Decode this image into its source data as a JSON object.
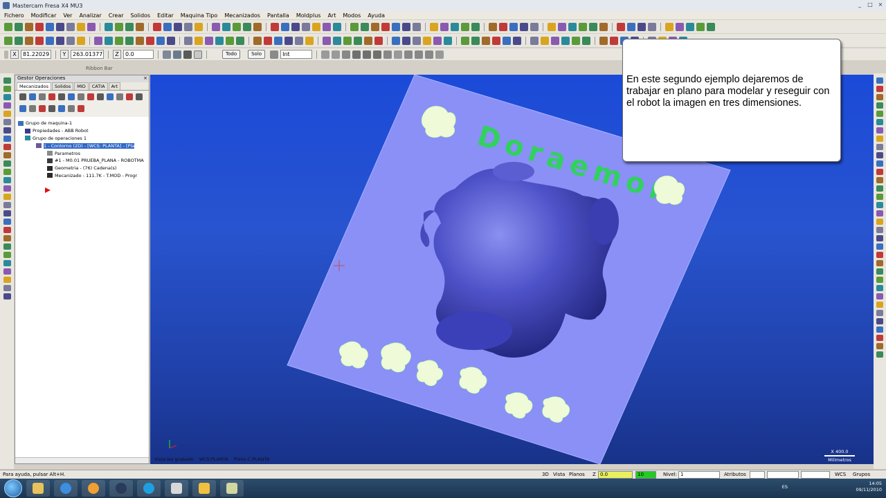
{
  "app": {
    "title": "Mastercam Fresa X4 MU3",
    "window_controls": [
      "_",
      "□",
      "×"
    ]
  },
  "menu": [
    "Fichero",
    "Modificar",
    "Ver",
    "Analizar",
    "Crear",
    "Solidos",
    "Editar",
    "Maquina Tipo",
    "Mecanizados",
    "Pantalla",
    "Moldplus",
    "Art",
    "Modos",
    "Ayuda"
  ],
  "coords": {
    "x_label": "X",
    "x_value": "81.22029",
    "y_label": "Y",
    "y_value": "263.01377",
    "z_label": "Z",
    "z_value": "0.0",
    "btn_todo": "Todo",
    "btn_solo": "Solo",
    "snap_value": "Int"
  },
  "ribbon_label": "Ribbon Bar",
  "panel": {
    "title": "Gestor Operaciones",
    "close": "×",
    "tabs": [
      "Mecanizados",
      "Solidos",
      "MID",
      "CATIA",
      "Art"
    ],
    "tree": [
      {
        "text": "Grupo de maquina-1",
        "indent": 4
      },
      {
        "text": "Propiedades - ABB Robot",
        "indent": 14
      },
      {
        "text": "Grupo de operaciones 1",
        "indent": 14
      },
      {
        "text": "1 - Contorno (2D) - [WCS: PLANTA] - [Pla",
        "indent": 30,
        "selected": true
      },
      {
        "text": "Parametros",
        "indent": 46
      },
      {
        "text": "#1 - M0.01 PRUEBA_PLANA - ROBOTMA",
        "indent": 46
      },
      {
        "text": "Geometria - (76) Cadena(s)",
        "indent": 46
      },
      {
        "text": "Mecanizado - 111.7K - T.MOD - Progr",
        "indent": 46
      }
    ]
  },
  "viewport": {
    "labels": [
      "Vista:Iso grabado",
      "WCS:PLANTA",
      "Plano C:PLANTA"
    ],
    "units_top": "X 400.0",
    "units": "Milimetros",
    "plate_text": "Doraemon"
  },
  "callout": {
    "text": "En este segundo ejemplo dejaremos de trabajar en plano para modelar y reseguir con el robot la imagen en tres dimensiones."
  },
  "status": {
    "help": "Para ayuda, pulsar Alt+H.",
    "mode": "3D",
    "vista": "Vista",
    "planos": "Planos",
    "z_label": "Z",
    "z_value": "0.0",
    "color_value": "10",
    "nivel_label": "Nivel:",
    "nivel_value": "1",
    "atributos": "Atributos",
    "wcs": "WCS",
    "grupos": "Grupos"
  },
  "taskbar": {
    "time": "14:05",
    "date": "09/11/2010",
    "lang": "ES"
  },
  "colors": {
    "viewport": "#2451d4",
    "plate": "#8a90f6",
    "model": "#4a4ec0",
    "callout_bg": "#ffffff",
    "selection": "#3168c6"
  }
}
